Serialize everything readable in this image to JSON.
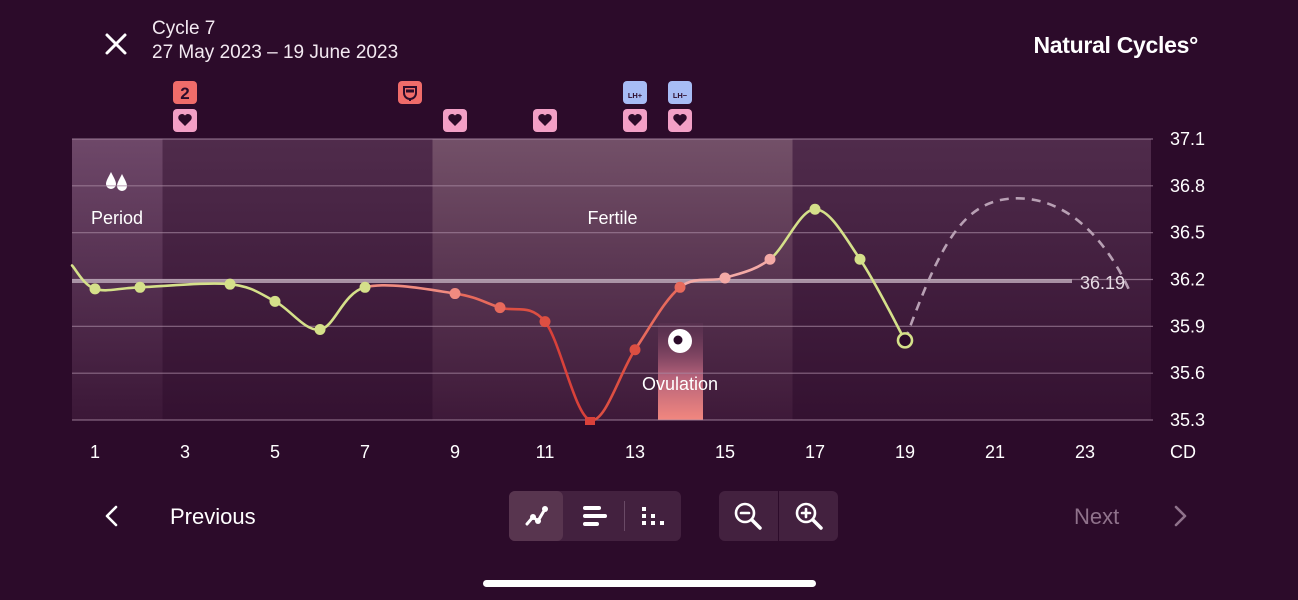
{
  "header": {
    "cycle_title": "Cycle 7",
    "cycle_dates": "27 May 2023 – 19 June 2023",
    "brand": "Natural Cycles°",
    "close_icon": "close-icon"
  },
  "chart_data": {
    "type": "line",
    "xlabel": "CD",
    "x_ticks": [
      "1",
      "3",
      "5",
      "7",
      "9",
      "11",
      "13",
      "15",
      "17",
      "19",
      "21",
      "23"
    ],
    "y_ticks": [
      "37.1",
      "36.8",
      "36.5",
      "36.2",
      "35.9",
      "35.6",
      "35.3"
    ],
    "ylim": [
      35.3,
      37.1
    ],
    "xlim": [
      0.5,
      24.5
    ],
    "coverline": 36.19,
    "coverline_label": "36.19",
    "points": [
      {
        "x": 1,
        "y": 36.14,
        "color": "#d5e08a"
      },
      {
        "x": 2,
        "y": 36.15,
        "color": "#d5e08a"
      },
      {
        "x": 4,
        "y": 36.17,
        "color": "#d5e08a"
      },
      {
        "x": 5,
        "y": 36.06,
        "color": "#d5e08a"
      },
      {
        "x": 6,
        "y": 35.88,
        "color": "#d5e08a"
      },
      {
        "x": 7,
        "y": 36.15,
        "color": "#d5e08a"
      },
      {
        "x": 9,
        "y": 36.11,
        "color": "#f08b80"
      },
      {
        "x": 10,
        "y": 36.02,
        "color": "#e76a5c"
      },
      {
        "x": 11,
        "y": 35.93,
        "color": "#dd4f42"
      },
      {
        "x": 12,
        "y": 35.3,
        "color": "#d9413a",
        "marker": "square"
      },
      {
        "x": 13,
        "y": 35.75,
        "color": "#dd4f42"
      },
      {
        "x": 14,
        "y": 36.15,
        "color": "#e76a5c"
      },
      {
        "x": 15,
        "y": 36.21,
        "color": "#f4aaa6"
      },
      {
        "x": 16,
        "y": 36.33,
        "color": "#f4aaa6"
      },
      {
        "x": 17,
        "y": 36.65,
        "color": "#d5e08a"
      },
      {
        "x": 18,
        "y": 36.33,
        "color": "#d5e08a"
      },
      {
        "x": 19,
        "y": 35.81,
        "color": "#d5e08a",
        "marker": "open"
      }
    ],
    "prediction": [
      [
        19,
        35.81
      ],
      [
        21.5,
        36.72
      ],
      [
        24,
        36.12
      ]
    ],
    "bands": [
      {
        "label": "Period",
        "from": 0.5,
        "to": 2.5,
        "icon": "drops-icon"
      },
      {
        "label": "Fertile",
        "from": 8.5,
        "to": 16.5
      },
      {
        "label": "Ovulation",
        "at": 14,
        "icon": "ovulation-egg-icon"
      }
    ],
    "markers": [
      {
        "cd": 3,
        "row": 1,
        "kind": "badge",
        "text": "2",
        "color": "#f06c6a"
      },
      {
        "cd": 3,
        "row": 2,
        "kind": "heart",
        "color": "#f2a0c6"
      },
      {
        "cd": 8,
        "row": 1,
        "kind": "cup",
        "color": "#f06c6a"
      },
      {
        "cd": 9,
        "row": 2,
        "kind": "heart",
        "color": "#f2a0c6"
      },
      {
        "cd": 11,
        "row": 2,
        "kind": "heart",
        "color": "#f2a0c6"
      },
      {
        "cd": 13,
        "row": 1,
        "kind": "lh",
        "text": "LH+",
        "color": "#a7bcf5"
      },
      {
        "cd": 13,
        "row": 2,
        "kind": "heart",
        "color": "#f2a0c6"
      },
      {
        "cd": 14,
        "row": 1,
        "kind": "lh",
        "text": "LH−",
        "color": "#a7bcf5"
      },
      {
        "cd": 14,
        "row": 2,
        "kind": "heart",
        "color": "#f2a0c6"
      }
    ]
  },
  "footer": {
    "previous_label": "Previous",
    "next_label": "Next",
    "view_buttons": [
      "graph-line-icon",
      "bars-icon",
      "dots-grid-icon"
    ],
    "zoom_buttons": [
      "zoom-out-icon",
      "zoom-in-icon"
    ]
  }
}
